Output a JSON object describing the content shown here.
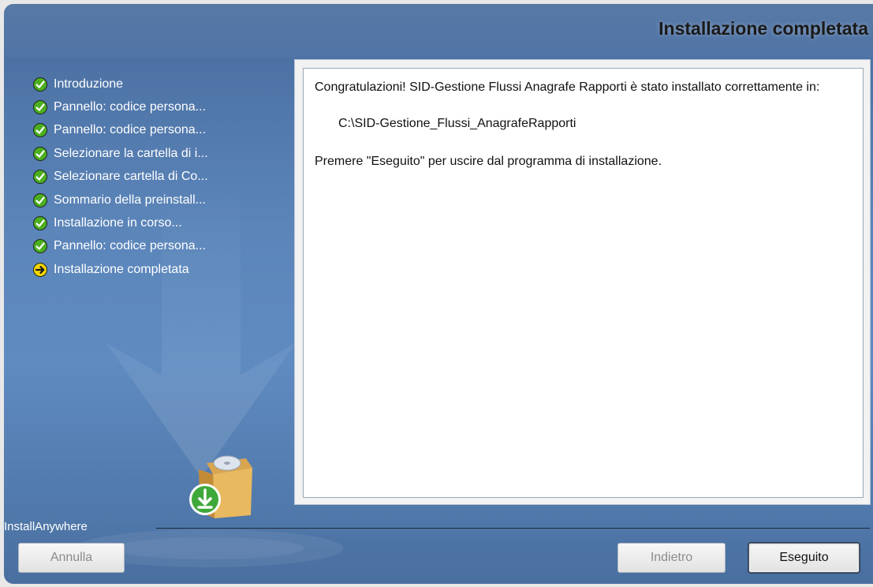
{
  "window": {
    "title": "Installazione completata"
  },
  "steps": [
    {
      "label": "Introduzione",
      "status": "done",
      "icon": "check-circle-icon"
    },
    {
      "label": "Pannello: codice persona...",
      "status": "done",
      "icon": "check-circle-icon"
    },
    {
      "label": "Pannello: codice persona...",
      "status": "done",
      "icon": "check-circle-icon"
    },
    {
      "label": "Selezionare la cartella di i...",
      "status": "done",
      "icon": "check-circle-icon"
    },
    {
      "label": "Selezionare cartella di Co...",
      "status": "done",
      "icon": "check-circle-icon"
    },
    {
      "label": "Sommario della preinstall...",
      "status": "done",
      "icon": "check-circle-icon"
    },
    {
      "label": "Installazione in corso...",
      "status": "done",
      "icon": "check-circle-icon"
    },
    {
      "label": "Pannello: codice persona...",
      "status": "done",
      "icon": "check-circle-icon"
    },
    {
      "label": "Installazione completata",
      "status": "current",
      "icon": "arrow-right-circle-icon"
    }
  ],
  "content": {
    "congrats": "Congratulazioni! SID-Gestione Flussi Anagrafe Rapporti è stato installato correttamente in:",
    "install_path": "C:\\SID-Gestione_Flussi_AnagrafeRapporti",
    "exit_hint": "Premere \"Eseguito\" per uscire dal programma di installazione."
  },
  "footer": {
    "brand": "InstallAnywhere",
    "cancel_label": "Annulla",
    "back_label": "Indietro",
    "done_label": "Eseguito"
  },
  "colors": {
    "panel_blue": "#5f8bc1",
    "done_green": "#4caf1f",
    "current_yellow": "#f5d400"
  }
}
